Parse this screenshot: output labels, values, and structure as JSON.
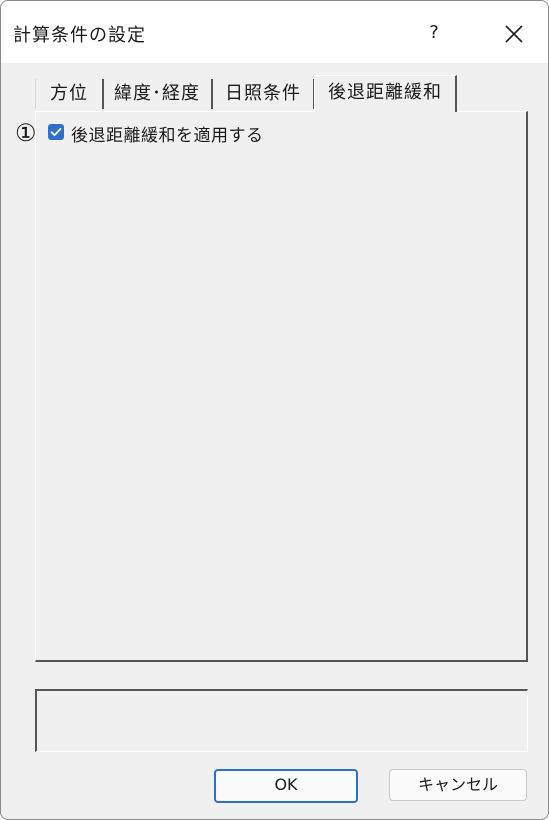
{
  "window": {
    "title": "計算条件の設定",
    "help_label": "?"
  },
  "tabs": [
    {
      "label": "方位",
      "active": false
    },
    {
      "label": "緯度･経度",
      "active": false
    },
    {
      "label": "日照条件",
      "active": false
    },
    {
      "label": "後退距離緩和",
      "active": true
    }
  ],
  "panel": {
    "marker": "①",
    "checkbox": {
      "label": "後退距離緩和を適用する",
      "checked": true
    }
  },
  "buttons": {
    "ok_label": "OK",
    "cancel_label": "キャンセル"
  },
  "colors": {
    "accent": "#2f6fc9",
    "dialog_bg": "#f0f0f0"
  }
}
